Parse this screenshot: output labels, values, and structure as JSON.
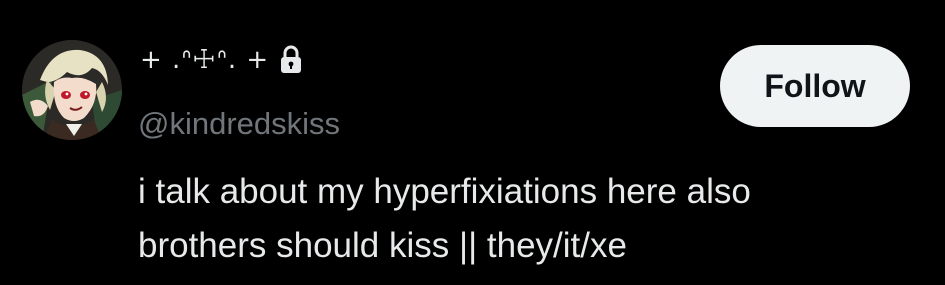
{
  "profile": {
    "display_name": "+ .ᐢ☩ᐢ. +",
    "locked_icon": "lock-icon",
    "handle": "@kindredskiss",
    "avatar_icon": "anime-character-avatar"
  },
  "actions": {
    "follow_label": "Follow"
  },
  "bio": {
    "line1": "i talk about my hyperfixiations here  also",
    "line2": "brothers should kiss || they/it/xe"
  },
  "colors": {
    "background": "#000000",
    "primary_text": "#e7e9ea",
    "secondary_text": "#71767b",
    "button_bg": "#eff3f4",
    "button_text": "#0f1419"
  }
}
